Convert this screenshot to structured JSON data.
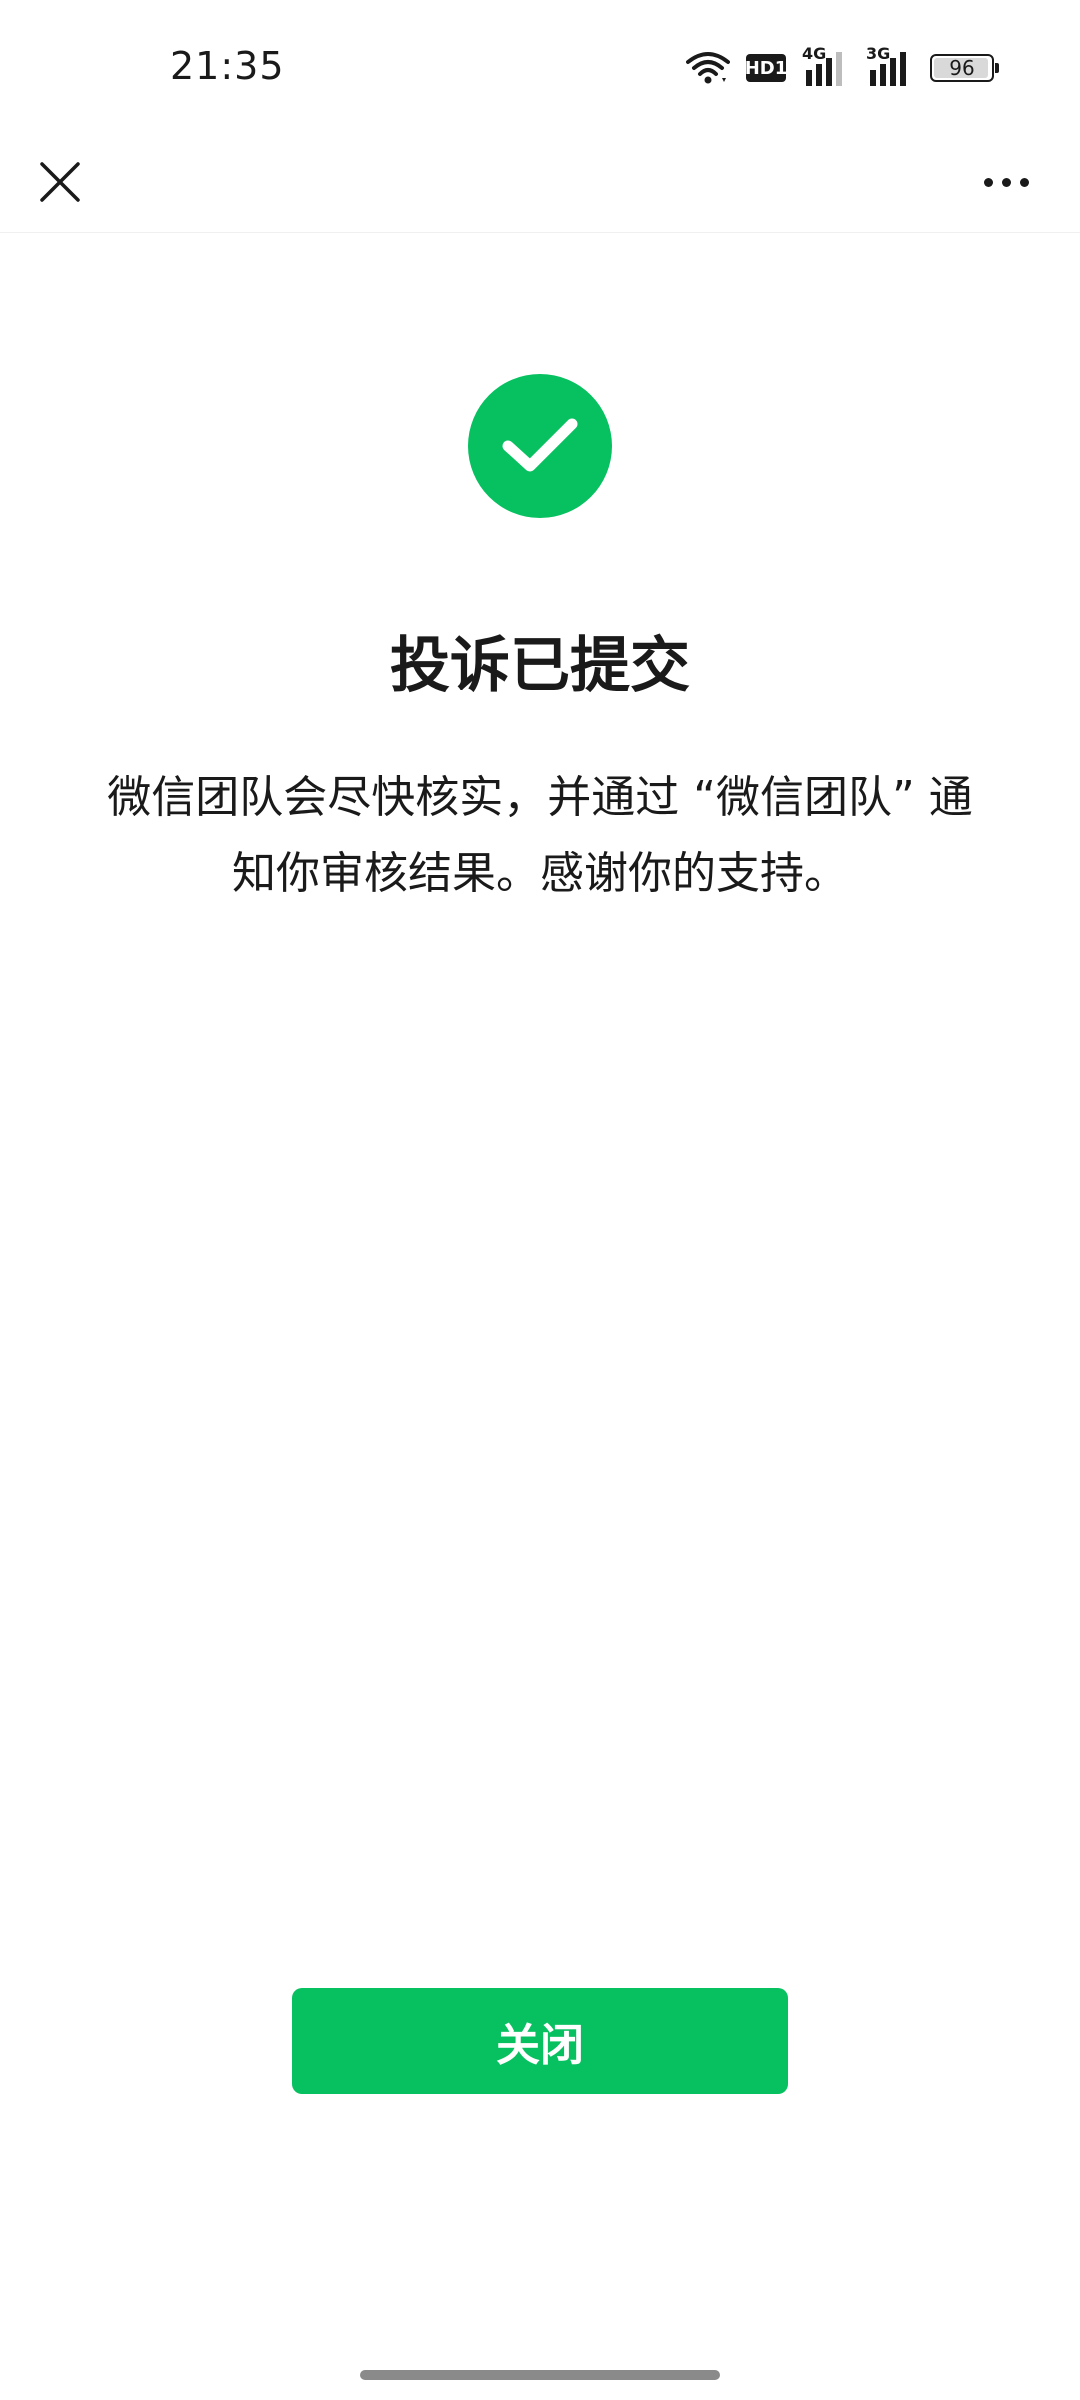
{
  "status_bar": {
    "time": "21:35",
    "hd_label": "HD1",
    "network_primary": "4G",
    "network_secondary": "3G",
    "battery_level": "96",
    "battery_fraction": 0.96
  },
  "nav": {
    "close_icon": "close-icon",
    "more_icon": "more-dots-icon"
  },
  "result": {
    "icon": "check-circle-icon",
    "title": "投诉已提交",
    "description": "微信团队会尽快核实，并通过 “微信团队” 通知你审核结果。感谢你的支持。"
  },
  "actions": {
    "close_label": "关闭"
  },
  "colors": {
    "accent": "#07c160",
    "text": "#1a1a1a"
  }
}
